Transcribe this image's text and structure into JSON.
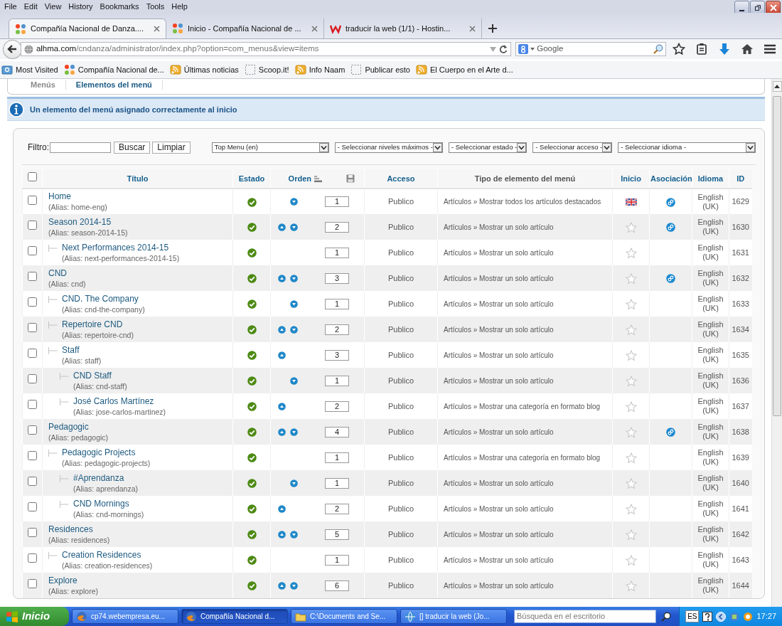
{
  "browser": {
    "menu": [
      "File",
      "Edit",
      "View",
      "History",
      "Bookmarks",
      "Tools",
      "Help"
    ],
    "tabs": [
      {
        "title": "Compañía Nacional de Danza....",
        "kind": "joomla",
        "selected": true
      },
      {
        "title": "Inicio - Compañía Nacional de ...",
        "kind": "joomla",
        "selected": false
      },
      {
        "title": "traducir la web (1/1) - Hostin...",
        "kind": "hosting",
        "selected": false
      }
    ],
    "url": {
      "host": "alhma.com",
      "path": "/cndanza/administrator/index.php?option=com_menus&view=items"
    },
    "search": {
      "placeholder": "Google"
    },
    "bookmarks": [
      {
        "label": "Most Visited",
        "kind": "folder"
      },
      {
        "label": "Compañía Nacional de...",
        "kind": "joomla"
      },
      {
        "label": "Últimas noticias",
        "kind": "rss"
      },
      {
        "label": "Scoop.it!",
        "kind": "blank"
      },
      {
        "label": "Info Naam",
        "kind": "rss"
      },
      {
        "label": "Publicar esto",
        "kind": "blank"
      },
      {
        "label": "El Cuerpo en el Arte d...",
        "kind": "rss"
      }
    ]
  },
  "admin": {
    "subtabs": [
      {
        "label": "Menús",
        "selected": false
      },
      {
        "label": "Elementos del menú",
        "selected": true
      }
    ],
    "message": "Un elemento del menú asignado correctamente al inicio",
    "filters": {
      "label": "Filtro:",
      "search_button": "Buscar",
      "clear_button": "Limpiar",
      "selects": [
        "Top Menu (en)",
        "- Seleccionar niveles máximos -",
        "- Seleccionar estado -",
        "- Seleccionar acceso -",
        "- Seleccionar idioma -"
      ]
    },
    "table": {
      "select_all_checked": false,
      "columns": [
        {
          "label": "Título",
          "sortable": true,
          "sorted": false,
          "kind": "text"
        },
        {
          "label": "Estado",
          "sortable": true,
          "sorted": false,
          "kind": "text"
        },
        {
          "label": "Orden",
          "sortable": true,
          "sorted": true,
          "kind": "order"
        },
        {
          "label": "Acceso",
          "sortable": true,
          "sorted": false,
          "kind": "text"
        },
        {
          "label": "Tipo de elemento del menú",
          "sortable": false,
          "sorted": false,
          "kind": "text"
        },
        {
          "label": "Inicio",
          "sortable": true,
          "sorted": false,
          "kind": "text"
        },
        {
          "label": "Asociación",
          "sortable": true,
          "sorted": false,
          "kind": "text"
        },
        {
          "label": "Idioma",
          "sortable": true,
          "sorted": false,
          "kind": "text"
        },
        {
          "label": "ID",
          "sortable": true,
          "sorted": false,
          "kind": "text"
        }
      ],
      "rows": [
        {
          "title": "Home",
          "alias": "(Alias: home-eng)",
          "checked": false,
          "published": true,
          "up": false,
          "down": true,
          "order": "1",
          "access": "Publico",
          "type": "Artículos » Mostrar todos los artículos destacados",
          "default": true,
          "association": true,
          "language": "English (UK)",
          "id": "1629"
        },
        {
          "title": "Season 2014-15",
          "alias": "(Alias: season-2014-15)",
          "checked": false,
          "published": true,
          "up": true,
          "down": true,
          "order": "2",
          "access": "Publico",
          "type": "Artículos » Mostrar un solo artículo",
          "default": false,
          "association": true,
          "language": "English (UK)",
          "id": "1630",
          "children": [
            {
              "title": "Next Performances 2014-15",
              "alias": "(Alias: next-performances-2014-15)",
              "checked": false,
              "published": true,
              "up": false,
              "down": false,
              "order": "1",
              "access": "Publico",
              "type": "Artículos » Mostrar un solo artículo",
              "default": false,
              "association": false,
              "language": "English (UK)",
              "id": "1631"
            }
          ]
        },
        {
          "title": "CND",
          "alias": "(Alias: cnd)",
          "checked": false,
          "published": true,
          "up": true,
          "down": true,
          "order": "3",
          "access": "Publico",
          "type": "Artículos » Mostrar un solo artículo",
          "default": false,
          "association": true,
          "language": "English (UK)",
          "id": "1632",
          "children": [
            {
              "title": "CND. The Company",
              "alias": "(Alias: cnd-the-company)",
              "checked": false,
              "published": true,
              "up": false,
              "down": true,
              "order": "1",
              "access": "Publico",
              "type": "Artículos » Mostrar un solo artículo",
              "default": false,
              "association": false,
              "language": "English (UK)",
              "id": "1633"
            },
            {
              "title": "Repertoire CND",
              "alias": "(Alias: repertoire-cnd)",
              "checked": false,
              "published": true,
              "up": true,
              "down": true,
              "order": "2",
              "access": "Publico",
              "type": "Artículos » Mostrar un solo artículo",
              "default": false,
              "association": false,
              "language": "English (UK)",
              "id": "1634"
            },
            {
              "title": "Staff",
              "alias": "(Alias: staff)",
              "checked": false,
              "published": true,
              "up": true,
              "down": false,
              "order": "3",
              "access": "Publico",
              "type": "Artículos » Mostrar un solo artículo",
              "default": false,
              "association": false,
              "language": "English (UK)",
              "id": "1635",
              "children": [
                {
                  "title": "CND Staff",
                  "alias": "(Alias: cnd-staff)",
                  "checked": false,
                  "published": true,
                  "up": false,
                  "down": true,
                  "order": "1",
                  "access": "Publico",
                  "type": "Artículos » Mostrar un solo artículo",
                  "default": false,
                  "association": false,
                  "language": "English (UK)",
                  "id": "1636"
                },
                {
                  "title": "José Carlos Martínez",
                  "alias": "(Alias: jose-carlos-martinez)",
                  "checked": false,
                  "published": true,
                  "up": true,
                  "down": false,
                  "order": "2",
                  "access": "Publico",
                  "type": "Artículos » Mostrar una categoría en formato blog",
                  "default": false,
                  "association": false,
                  "language": "English (UK)",
                  "id": "1637"
                }
              ]
            }
          ]
        },
        {
          "title": "Pedagogic",
          "alias": "(Alias: pedagogic)",
          "checked": false,
          "published": true,
          "up": true,
          "down": true,
          "order": "4",
          "access": "Publico",
          "type": "Artículos » Mostrar un solo artículo",
          "default": false,
          "association": true,
          "language": "English (UK)",
          "id": "1638",
          "children": [
            {
              "title": "Pedagogic Projects",
              "alias": "(Alias: pedagogic-projects)",
              "checked": false,
              "published": true,
              "up": false,
              "down": false,
              "order": "1",
              "access": "Publico",
              "type": "Artículos » Mostrar una categoría en formato blog",
              "default": false,
              "association": false,
              "language": "English (UK)",
              "id": "1639",
              "children": [
                {
                  "title": "#Aprendanza",
                  "alias": "(Alias: aprendanza)",
                  "checked": false,
                  "published": true,
                  "up": false,
                  "down": true,
                  "order": "1",
                  "access": "Publico",
                  "type": "Artículos » Mostrar un solo artículo",
                  "default": false,
                  "association": false,
                  "language": "English (UK)",
                  "id": "1640"
                },
                {
                  "title": "CND Mornings",
                  "alias": "(Alias: cnd-mornings)",
                  "checked": false,
                  "published": true,
                  "up": true,
                  "down": false,
                  "order": "2",
                  "access": "Publico",
                  "type": "Artículos » Mostrar un solo artículo",
                  "default": false,
                  "association": false,
                  "language": "English (UK)",
                  "id": "1641"
                }
              ]
            }
          ]
        },
        {
          "title": "Residences",
          "alias": "(Alias: residences)",
          "checked": false,
          "published": true,
          "up": true,
          "down": true,
          "order": "5",
          "access": "Publico",
          "type": "Artículos » Mostrar un solo artículo",
          "default": false,
          "association": false,
          "language": "English (UK)",
          "id": "1642",
          "children": [
            {
              "title": "Creation Residences",
              "alias": "(Alias: creation-residences)",
              "checked": false,
              "published": true,
              "up": false,
              "down": false,
              "order": "1",
              "access": "Publico",
              "type": "Artículos » Mostrar un solo artículo",
              "default": false,
              "association": false,
              "language": "English (UK)",
              "id": "1643"
            }
          ]
        },
        {
          "title": "Explore",
          "alias": "(Alias: explore)",
          "checked": false,
          "published": true,
          "up": true,
          "down": true,
          "order": "6",
          "access": "Publico",
          "type": "Artículos » Mostrar un solo artículo",
          "default": false,
          "association": false,
          "language": "English (UK)",
          "id": "1644"
        }
      ]
    }
  },
  "taskbar": {
    "start": "Inicio",
    "tasks": [
      {
        "label": "cp74.webempresa.eu...",
        "kind": "firefox",
        "selected": false
      },
      {
        "label": "Compañía Nacional d...",
        "kind": "firefox",
        "selected": true
      },
      {
        "label": "C:\\Documents and Se...",
        "kind": "folder",
        "selected": false
      },
      {
        "label": "[] traducir la web (Jo...",
        "kind": "globe",
        "selected": false
      }
    ],
    "search": {
      "placeholder": "Búsqueda en el escritorio"
    },
    "language": "ES",
    "clock": "17:27"
  }
}
